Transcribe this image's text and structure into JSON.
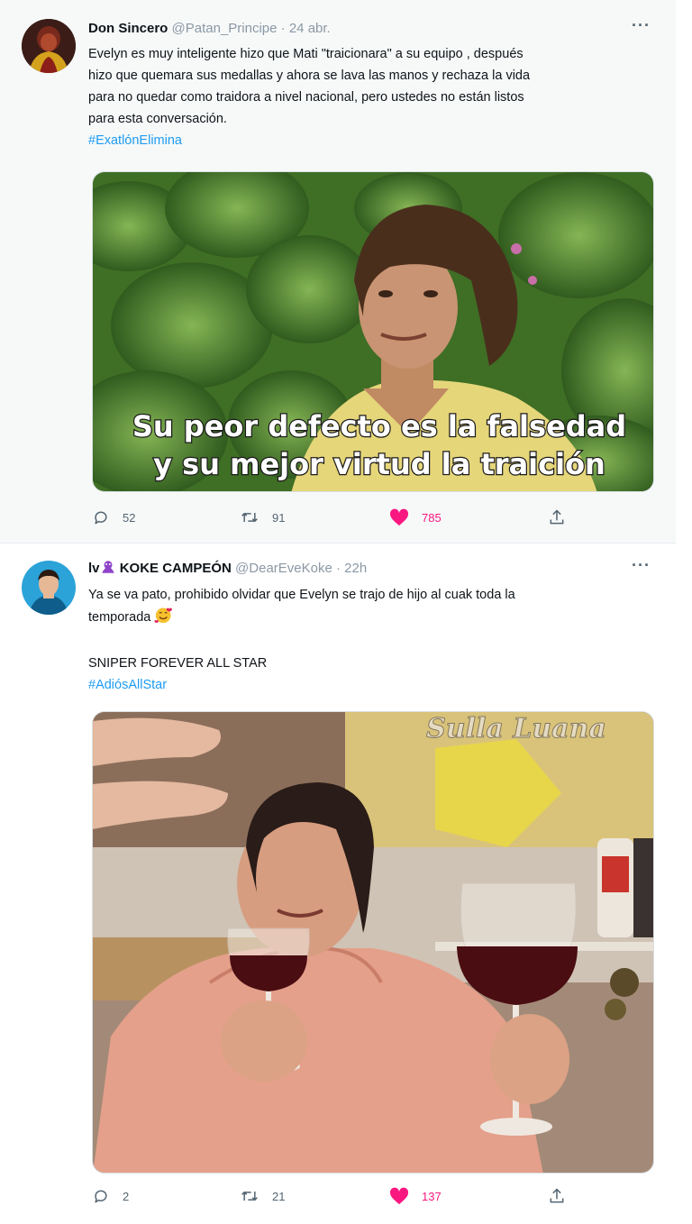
{
  "tweets": [
    {
      "author": {
        "name": "Don Sincero",
        "handle": "@Patan_Principe",
        "time": "24 abr."
      },
      "more_label": "···",
      "text_lines": [
        "Evelyn es muy inteligente hizo que Mati \"traicionara\" a su equipo , después",
        "hizo que quemara sus medallas y ahora se lava las manos y rechaza la vida",
        "para no quedar como traidora a nivel nacional, pero ustedes no están listos",
        "para esta conversación."
      ],
      "hashtag": "#ExatlónElimina",
      "media": {
        "caption_line1": "Su peor defecto es la falsedad",
        "caption_line2": "y su mejor virtud la traición"
      },
      "stats": {
        "replies": "52",
        "retweets": "91",
        "likes": "785"
      }
    },
    {
      "author": {
        "name_prefix": "lv",
        "name": "KOKE CAMPEÓN",
        "handle": "@DearEveKoke",
        "time": "22h"
      },
      "more_label": "···",
      "text_lines": [
        "Ya se va pato, prohibido olvidar que Evelyn se trajo de hijo al cuak toda la",
        "temporada"
      ],
      "text_extra": "SNIPER FOREVER ALL STAR",
      "hashtag": "#AdiósAllStar",
      "media": {
        "watermark": "Sulla Luana"
      },
      "stats": {
        "replies": "2",
        "retweets": "21",
        "likes": "137"
      }
    }
  ],
  "icons": {
    "reply": "reply-icon",
    "retweet": "retweet-icon",
    "like": "heart-icon",
    "share": "share-icon",
    "purple_heart": "purple-heart-emoji",
    "smiling_hearts": "smiling-face-with-hearts-emoji"
  },
  "colors": {
    "hashtag": "#1d9bf0",
    "like_active": "#f91880",
    "muted": "#536471",
    "caption_text": "#ffffff"
  }
}
